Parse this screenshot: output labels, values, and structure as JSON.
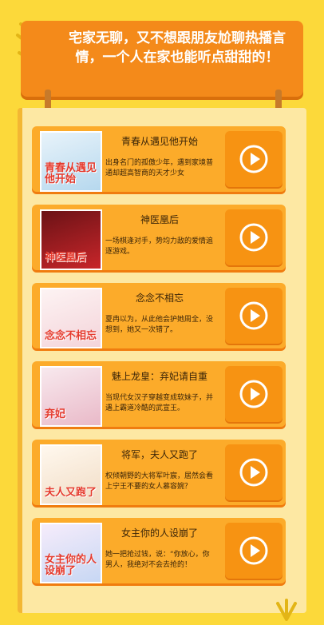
{
  "banner": {
    "text": "宅家无聊，又不想跟朋友尬聊热播言情，一个人在家也能听点甜甜的！"
  },
  "books": [
    {
      "title": "青春从遇见他开始",
      "description": "出身名门的孤傲少年，遇到家境普通却超高智商的天才少女",
      "cover_text": "青春从遇见他开始",
      "cover_colors": [
        "#e8f3fa",
        "#b6d8ee"
      ]
    },
    {
      "title": "神医凰后",
      "description": "一场棋逢对手，势均力敌的爱情追逐游戏。",
      "cover_text": "神医凰后",
      "cover_colors": [
        "#6b1216",
        "#c8262a"
      ]
    },
    {
      "title": "念念不相忘",
      "description": "夏冉以为，从此他会护她周全，没想到，她又一次错了。",
      "cover_text": "念念不相忘",
      "cover_colors": [
        "#fdf3f3",
        "#f4d4da"
      ]
    },
    {
      "title": "魅上龙皇：弃妃请自重",
      "description": "当现代女汉子穿越变成软妹子，并遇上霸道冷酷的武宣王。",
      "cover_text": "弃妃",
      "cover_colors": [
        "#f8e9ee",
        "#e9b9c8"
      ]
    },
    {
      "title": "将军，夫人又跑了",
      "description": "权倾朝野的大将军叶宸，居然会看上宁王不要的女人慕容婉？",
      "cover_text": "夫人又跑了",
      "cover_colors": [
        "#fff8ee",
        "#f1dcc5"
      ]
    },
    {
      "title": "女主你的人设崩了",
      "description": "她一把抢过钱，说：“你放心，你男人，我绝对不会去抢的！",
      "cover_text": "女主你的人设崩了",
      "cover_colors": [
        "#f6ecfb",
        "#c7d7f3"
      ]
    }
  ]
}
